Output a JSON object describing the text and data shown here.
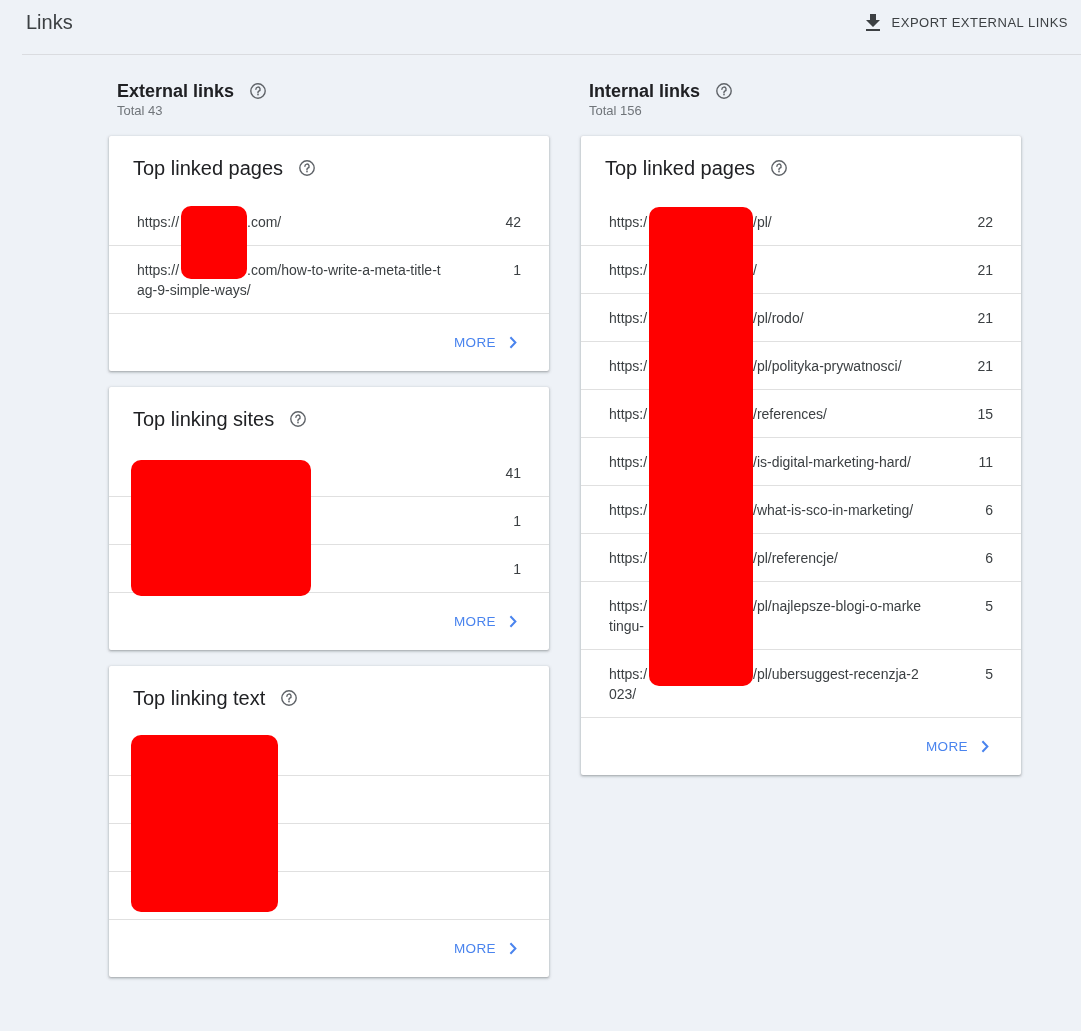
{
  "header": {
    "title": "Links",
    "export_button": "EXPORT EXTERNAL LINKS"
  },
  "columns": [
    {
      "title": "External links",
      "total": "Total 43",
      "cards": [
        {
          "title": "Top linked pages",
          "redacted": true,
          "rows": [
            {
              "lines": [
                [
                  "https://",
                  ".com/"
                ]
              ],
              "count": "42"
            },
            {
              "lines": [
                [
                  "https://",
                  ".com/how-to-write-a-meta-title-t"
                ],
                [
                  "ag-9-simple-ways/"
                ]
              ],
              "count": "1"
            }
          ],
          "more": "MORE"
        },
        {
          "title": "Top linking sites",
          "redacted": true,
          "rows": [
            {
              "count": "41"
            },
            {
              "count": "1"
            },
            {
              "count": "1"
            }
          ],
          "more": "MORE"
        },
        {
          "title": "Top linking text",
          "redacted": true,
          "rows": [
            {},
            {},
            {},
            {}
          ],
          "more": "MORE"
        }
      ]
    },
    {
      "title": "Internal links",
      "total": "Total 156",
      "cards": [
        {
          "title": "Top linked pages",
          "redacted": true,
          "rows": [
            {
              "lines": [
                [
                  "https:/",
                  "/pl/"
                ]
              ],
              "count": "22"
            },
            {
              "lines": [
                [
                  "https:/",
                  "/"
                ]
              ],
              "count": "21"
            },
            {
              "lines": [
                [
                  "https:/",
                  "/pl/rodo/"
                ]
              ],
              "count": "21"
            },
            {
              "lines": [
                [
                  "https:/",
                  "/pl/polityka-prywatnosci/"
                ]
              ],
              "count": "21"
            },
            {
              "lines": [
                [
                  "https:/",
                  "/references/"
                ]
              ],
              "count": "15"
            },
            {
              "lines": [
                [
                  "https:/",
                  "/is-digital-marketing-hard/"
                ]
              ],
              "count": "11"
            },
            {
              "lines": [
                [
                  "https:/",
                  "/what-is-sco-in-marketing/"
                ]
              ],
              "count": "6"
            },
            {
              "lines": [
                [
                  "https:/",
                  "/pl/referencje/"
                ]
              ],
              "count": "6"
            },
            {
              "lines": [
                [
                  "https:/",
                  "/pl/najlepsze-blogi-o-marke"
                ],
                [
                  "tingu-"
                ]
              ],
              "count": "5"
            },
            {
              "lines": [
                [
                  "https:/",
                  "/pl/ubersuggest-recenzja-2"
                ],
                [
                  "023/"
                ]
              ],
              "count": "5"
            }
          ],
          "more": "MORE"
        }
      ]
    }
  ]
}
